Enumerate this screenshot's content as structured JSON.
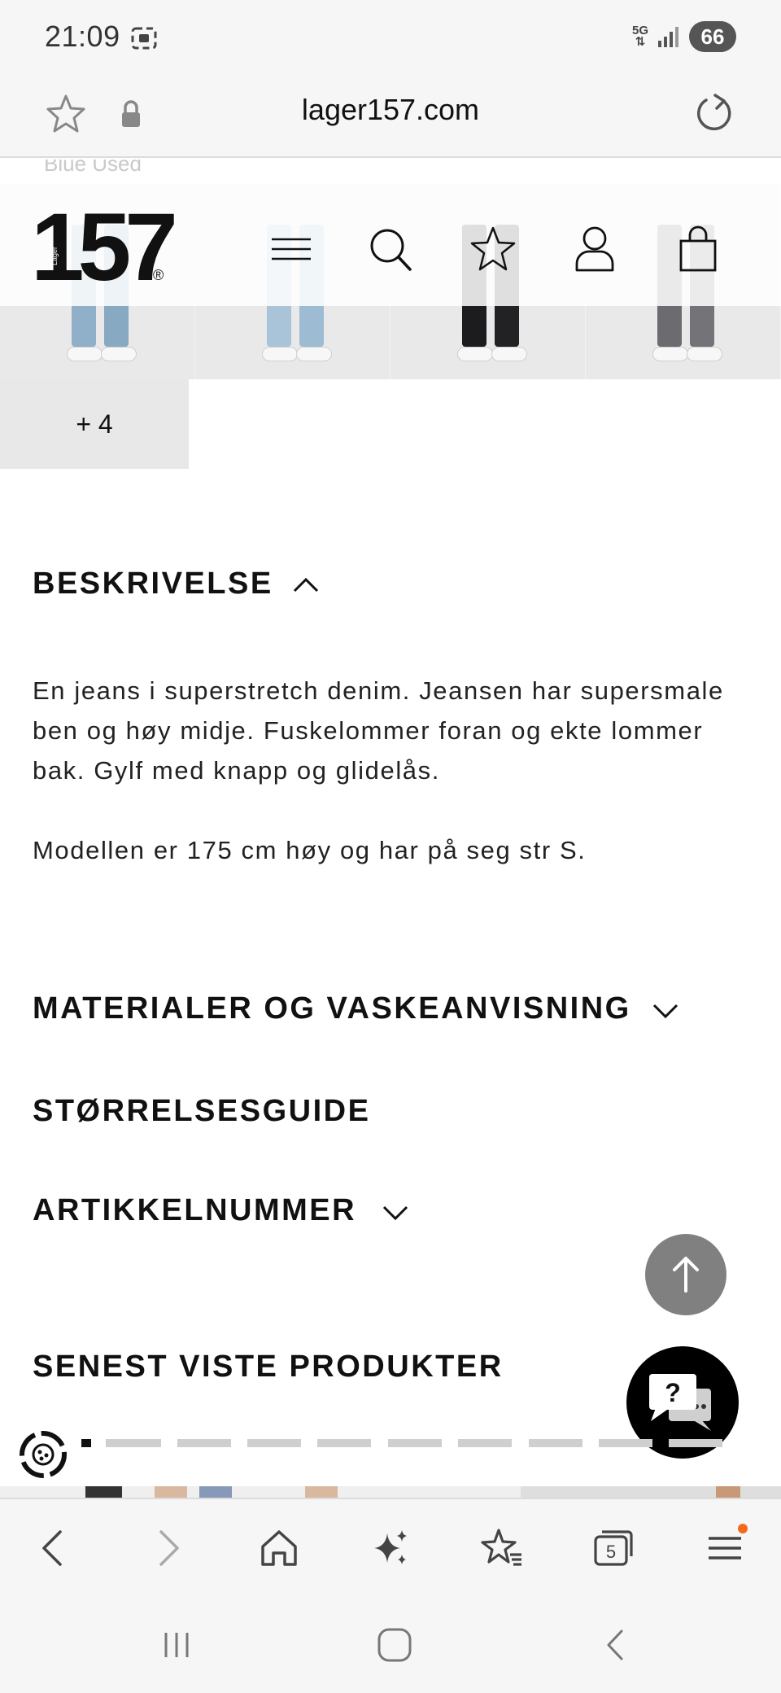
{
  "status_bar": {
    "time": "21:09",
    "network": "5G",
    "battery": "66"
  },
  "browser": {
    "url": "lager157.com",
    "tabs_count": "5"
  },
  "header": {
    "logo_text": "157",
    "logo_sub": "Lager",
    "logo_registered": "®",
    "icons": [
      "menu-icon",
      "search-icon",
      "star-icon",
      "user-icon",
      "bag-icon"
    ]
  },
  "product": {
    "partial_color_label": "Blue Used",
    "more_colors_label": "+ 4"
  },
  "sections": {
    "description_title": "BESKRIVELSE",
    "description_p1": "En jeans i superstretch denim. Jeansen har supersmale ben og høy midje. Fuskelommer foran og ekte lommer bak. Gylf med knapp og glidelås.",
    "description_p2": "Modellen er 175 cm høy og har på seg str S.",
    "materials_title": "MATERIALER OG VASKEANVISNING",
    "size_guide_title": "STØRRELSESGUIDE",
    "article_number_title": "ARTIKKELNUMMER",
    "recently_viewed_title": "SENEST VISTE PRODUKTER"
  },
  "chat": {
    "label": "?"
  },
  "colors": {
    "scroll_top_bg": "#808080",
    "chat_bg": "#000000",
    "notification_dot": "#f26b1d",
    "thumb_bg": "#e9e9ea"
  }
}
